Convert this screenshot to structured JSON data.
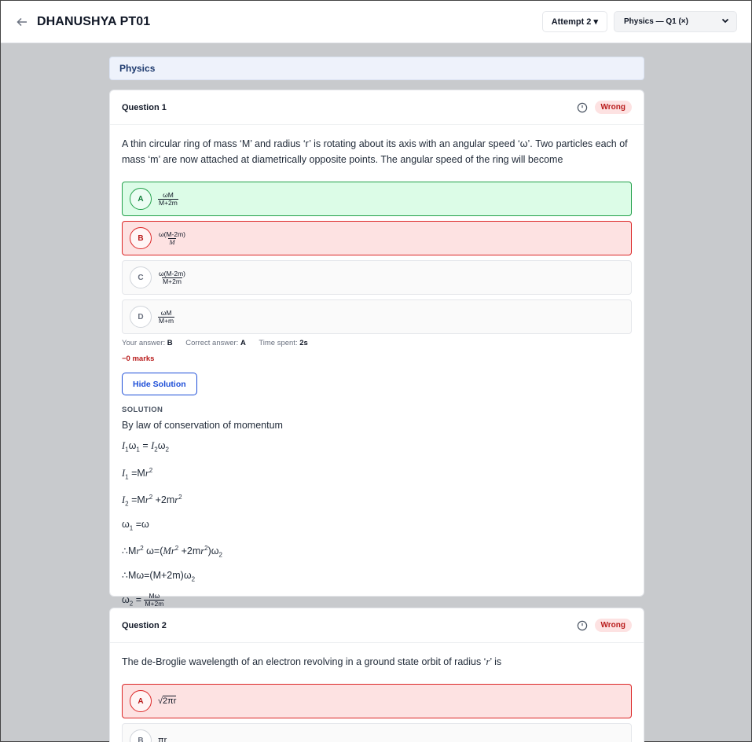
{
  "header": {
    "title": "DHANUSHYA PT01",
    "attempt_label": "Attempt 2 ▾",
    "question_select": "Physics — Q1 (×)"
  },
  "subject": "Physics",
  "question1": {
    "title": "Question 1",
    "status": "Wrong",
    "text": "A thin circular ring of mass ‘M’ and radius ‘r’ is rotating about its axis with an angular speed ‘ω’. Two particles each of mass ‘m’ are now attached at diametrically opposite points. The angular speed of the ring will become",
    "options": [
      {
        "letter": "A",
        "num": "ωM",
        "den": "M+2m"
      },
      {
        "letter": "B",
        "num": "ω(M-2m)",
        "den": "M"
      },
      {
        "letter": "C",
        "num": "ω(M-2m)",
        "den": "M+2m"
      },
      {
        "letter": "D",
        "num": "ωM",
        "den": "M+m"
      }
    ],
    "your_answer_label": "Your answer:",
    "your_answer": "B",
    "correct_answer_label": "Correct answer:",
    "correct_answer": "A",
    "time_label": "Time spent:",
    "time": "2s",
    "marks": "−0 marks",
    "hide_solution": "Hide Solution",
    "solution_label": "SOLUTION",
    "solution_intro": "By law of conservation of momentum"
  },
  "question2": {
    "title": "Question 2",
    "status": "Wrong",
    "text_before": "The de-Broglie wavelength of an electron revolving in a ground state orbit of radius ‘",
    "text_var": "r",
    "text_after": "’ is",
    "options": [
      {
        "letter": "A",
        "value": "2πr"
      },
      {
        "letter": "B",
        "value": "πr"
      }
    ]
  },
  "colors": {
    "correct_bg": "#dcfce7",
    "correct_border": "#22a04a",
    "wrong_bg": "#fde2e2",
    "wrong_border": "#dc2626",
    "accent": "#1d4ed8"
  }
}
